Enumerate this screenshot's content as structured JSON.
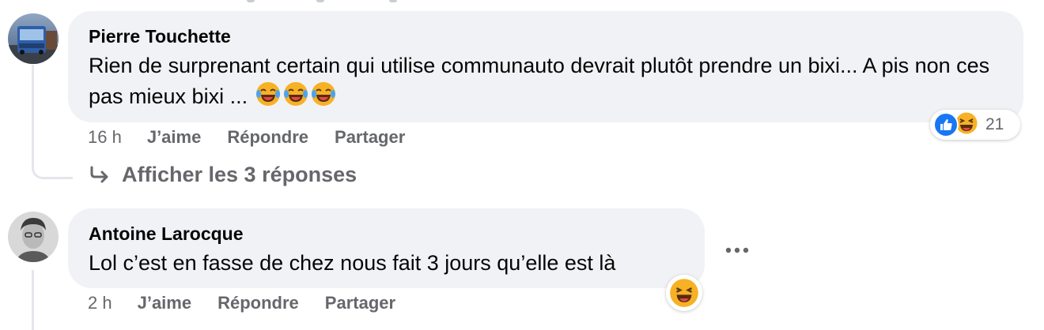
{
  "comments": [
    {
      "author": "Pierre Touchette",
      "text": "Rien de surprenant certain qui utilise communauto devrait plutôt prendre un bixi... A pis non ces pas mieux bixi ...",
      "emojis": [
        "laughing-tears-icon",
        "laughing-tears-icon",
        "laughing-tears-icon"
      ],
      "time": "16 h",
      "like_label": "J’aime",
      "reply_label": "Répondre",
      "share_label": "Partager",
      "reactions": {
        "types": [
          "like-icon",
          "haha-icon"
        ],
        "count": "21"
      },
      "view_replies": "Afficher les 3 réponses"
    },
    {
      "author": "Antoine Larocque",
      "text": "Lol c’est en fasse de chez nous fait 3 jours qu’elle est là",
      "time": "2 h",
      "like_label": "J’aime",
      "reply_label": "Répondre",
      "share_label": "Partager",
      "reactions": {
        "types": [
          "haha-icon"
        ]
      }
    }
  ],
  "colors": {
    "bubble": "#f0f2f5",
    "secondary_text": "#65676b",
    "like_blue": "#1877f2",
    "haha_yellow": "#f7b125"
  }
}
